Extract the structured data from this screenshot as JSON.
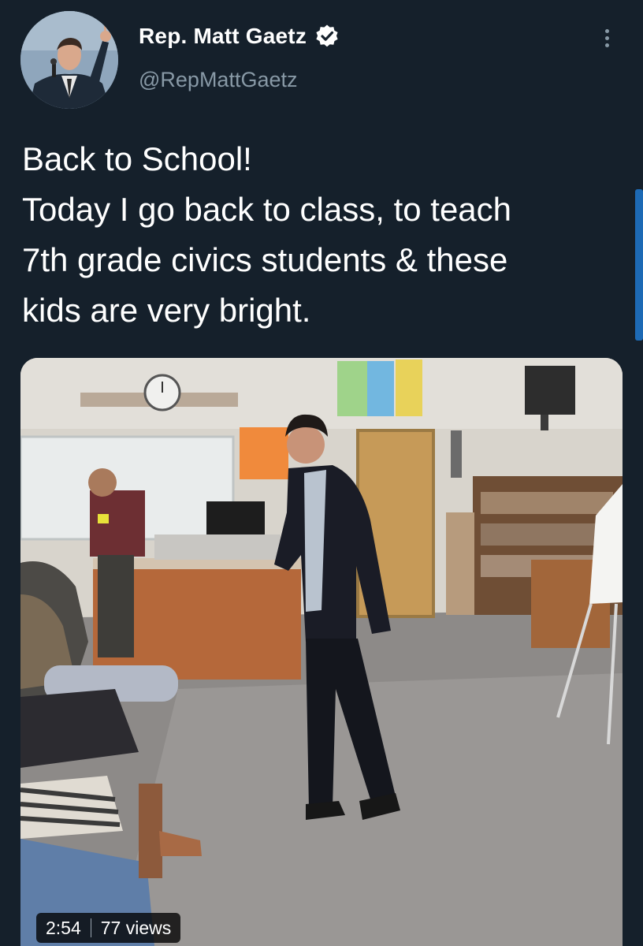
{
  "author": {
    "display_name": "Rep. Matt Gaetz",
    "handle": "@RepMattGaetz",
    "verified": true
  },
  "tweet": {
    "lines": [
      "Back to School!",
      "Today I go back to class, to teach",
      "7th grade civics students & these",
      "kids are very bright."
    ]
  },
  "media": {
    "type": "video",
    "duration": "2:54",
    "views": "77 views"
  },
  "colors": {
    "background": "#15202b",
    "text": "#ffffff",
    "secondary_text": "#8899a6",
    "accent": "#1d9bf0"
  },
  "icons": {
    "verified": "verified-badge-icon",
    "more": "more-vertical-icon"
  }
}
